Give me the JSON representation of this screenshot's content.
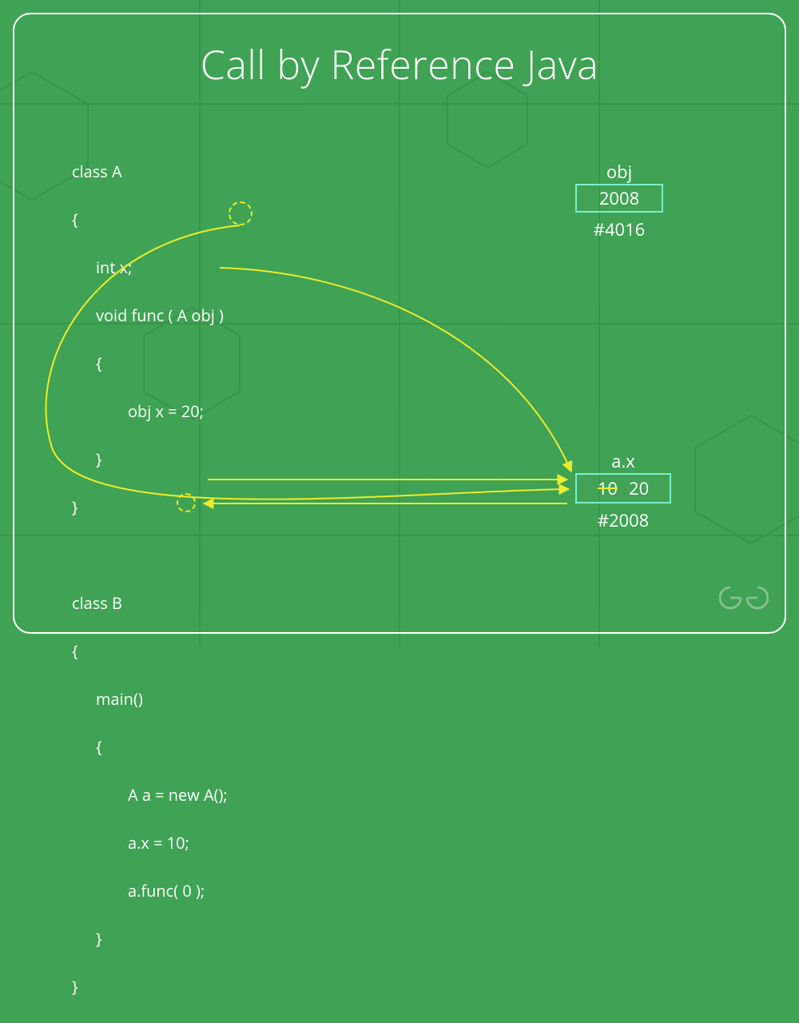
{
  "title": "Call by Reference Java",
  "code": {
    "ca": "class A",
    "ob": "{",
    "intx": "int x;",
    "vf_a": "void func ( A ",
    "vf_obj": "obj",
    "vf_b": " )",
    "ob2": "{",
    "assign": "obj x = 20;",
    "cb2": "}",
    "cb": "}",
    "cbb": "class B",
    "ob3": "{",
    "main": "main()",
    "ob4": "{",
    "new": "A a = new A();",
    "ax10": "a.x = 10;",
    "afunc_a": "a.func( ",
    "afunc_arg": "0",
    "afunc_b": " );",
    "cb4": "}",
    "cb3": "}"
  },
  "obj_box": {
    "label": "obj",
    "value": "2008",
    "addr": "#4016"
  },
  "ax_box": {
    "label": "a.x",
    "old": "10",
    "new": "20",
    "addr": "#2008"
  },
  "logo": "GG"
}
